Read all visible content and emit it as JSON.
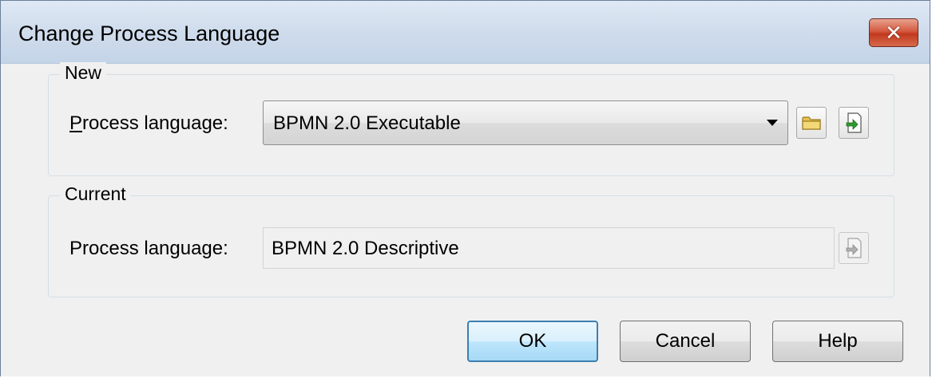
{
  "window": {
    "title": "Change Process Language",
    "close_glyph": "✕"
  },
  "new_group": {
    "legend": "New",
    "label_accel": "P",
    "label_rest": "rocess language:",
    "selected_value": "BPMN 2.0 Executable",
    "browse_icon": "folder-icon",
    "import_icon": "import-icon"
  },
  "current_group": {
    "legend": "Current",
    "label": "Process language:",
    "value": "BPMN 2.0 Descriptive",
    "import_icon": "import-icon"
  },
  "buttons": {
    "ok": "OK",
    "cancel": "Cancel",
    "help": "Help"
  },
  "colors": {
    "titlebar": "#cfdcec",
    "close_button": "#c23a1d",
    "default_button_border": "#3c7fb1",
    "import_arrow": "#2e9b2e",
    "folder": "#e8c252"
  }
}
